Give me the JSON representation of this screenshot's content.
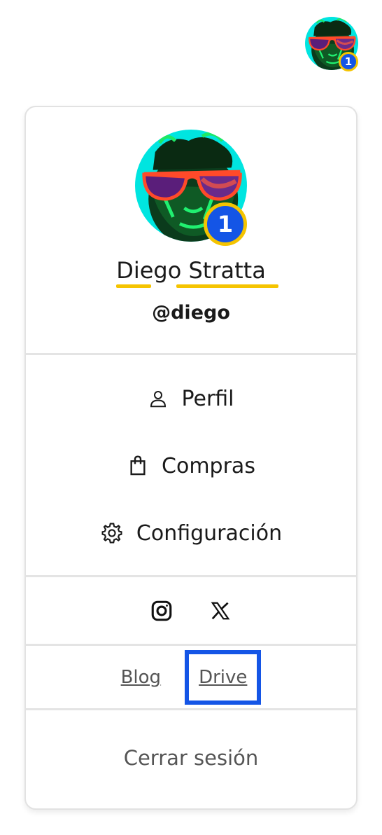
{
  "header": {
    "avatar_badge_count": "1"
  },
  "profile": {
    "name": "Diego Stratta",
    "username": "@diego",
    "avatar_badge_count": "1",
    "accent_color": "#f5c400",
    "badge_color": "#1455e6"
  },
  "menu": {
    "items": [
      {
        "label": "Perfil",
        "icon": "user-icon"
      },
      {
        "label": "Compras",
        "icon": "shopping-bag-icon"
      },
      {
        "label": "Configuración",
        "icon": "gear-icon"
      }
    ]
  },
  "social": {
    "icons": [
      "instagram-icon",
      "x-icon"
    ]
  },
  "links": {
    "blog": "Blog",
    "drive": "Drive",
    "highlight_color": "#1455e6"
  },
  "logout": {
    "label": "Cerrar sesión"
  }
}
